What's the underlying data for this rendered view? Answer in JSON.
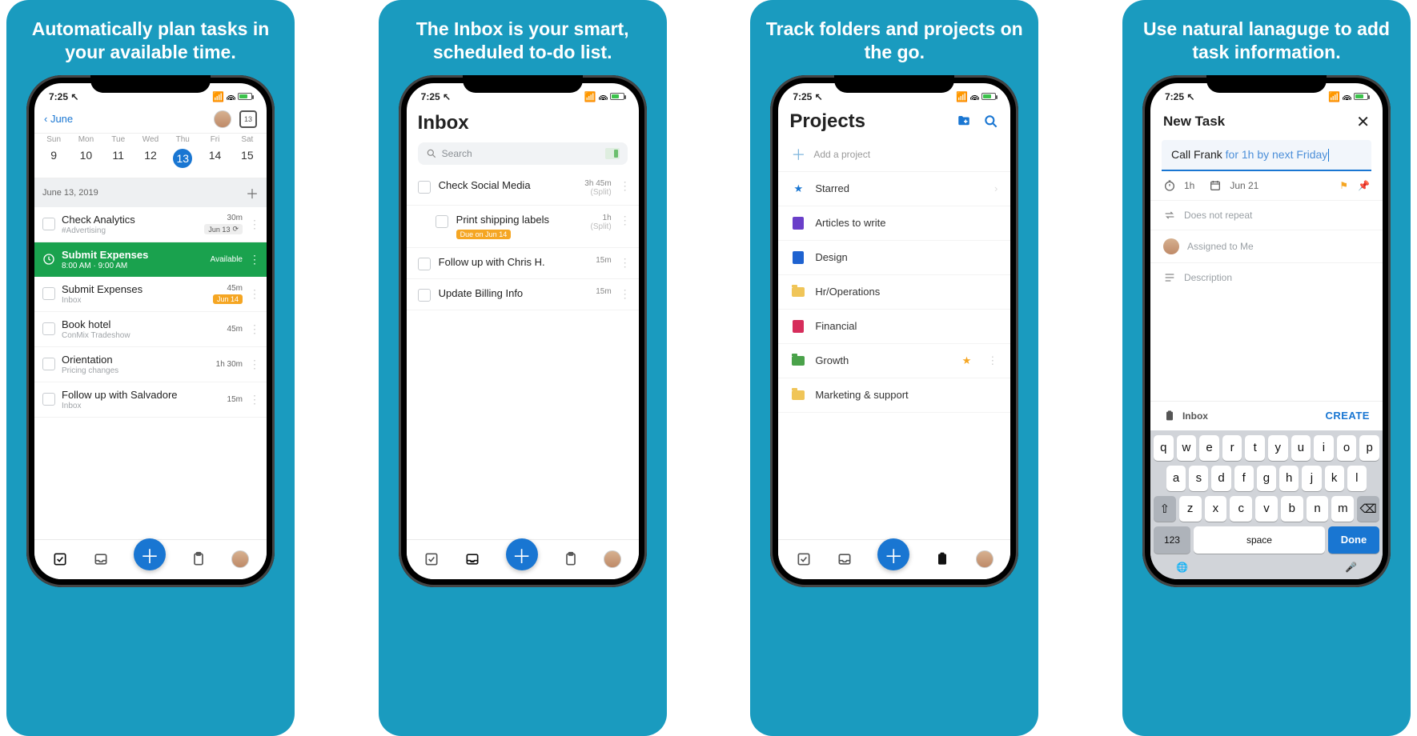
{
  "status": {
    "time": "7:25",
    "dayIcon": "13"
  },
  "panels": [
    {
      "caption": "Automatically plan tasks in your available time."
    },
    {
      "caption": "The Inbox is your smart, scheduled to-do list."
    },
    {
      "caption": "Track folders and projects on the go."
    },
    {
      "caption": "Use natural lanaguge to add task information."
    }
  ],
  "screen1": {
    "backLabel": "June",
    "weekdays": [
      "Sun",
      "Mon",
      "Tue",
      "Wed",
      "Thu",
      "Fri",
      "Sat"
    ],
    "dates": [
      "9",
      "10",
      "11",
      "12",
      "13",
      "14",
      "15"
    ],
    "selectedIndex": 4,
    "sectionDate": "June 13, 2019",
    "tasks": [
      {
        "title": "Check Analytics",
        "sub": "#Advertising",
        "dur": "30m",
        "badge": "Jun 13",
        "badgeKind": "due",
        "repeat": true
      },
      {
        "title": "Submit Expenses",
        "sub": "8:00 AM · 9:00 AM",
        "dur": "",
        "badge": "Available",
        "badgeKind": "green",
        "highlight": true
      },
      {
        "title": "Submit Expenses",
        "sub": "Inbox",
        "dur": "45m",
        "badge": "Jun 14",
        "badgeKind": "orange"
      },
      {
        "title": "Book hotel",
        "sub": "ConMix Tradeshow",
        "dur": "45m"
      },
      {
        "title": "Orientation",
        "sub": "Pricing changes",
        "dur": "1h 30m"
      },
      {
        "title": "Follow up with Salvadore",
        "sub": "Inbox",
        "dur": "15m"
      }
    ]
  },
  "screen2": {
    "title": "Inbox",
    "searchPlaceholder": "Search",
    "items": [
      {
        "title": "Check Social Media",
        "meta": "3h 45m",
        "sub": "(Split)"
      },
      {
        "title": "Print shipping labels",
        "meta": "1h",
        "sub": "(Split)",
        "due": "Due on Jun 14",
        "indent": true
      },
      {
        "title": "Follow up with Chris H.",
        "meta": "15m"
      },
      {
        "title": "Update Billing Info",
        "meta": "15m"
      }
    ]
  },
  "screen3": {
    "title": "Projects",
    "addLabel": "Add a project",
    "items": [
      {
        "icon": "star",
        "label": "Starred",
        "chev": true
      },
      {
        "icon": "doc",
        "color": "#6a3fc9",
        "label": "Articles to write"
      },
      {
        "icon": "doc",
        "color": "#1e62d0",
        "label": "Design"
      },
      {
        "icon": "folder",
        "color": "#f0c558",
        "label": "Hr/Operations"
      },
      {
        "icon": "doc",
        "color": "#d62d5b",
        "label": "Financial"
      },
      {
        "icon": "folder",
        "color": "#4aa24a",
        "label": "Growth",
        "star": true
      },
      {
        "icon": "folder",
        "color": "#f0c558",
        "label": "Marketing & support"
      }
    ]
  },
  "screen4": {
    "title": "New Task",
    "entry": {
      "text": "Call Frank ",
      "hint": "for 1h by next Friday"
    },
    "timerLabel": "1h",
    "dateLabel": "Jun 21",
    "repeatLabel": "Does not repeat",
    "assignLabel": "Assigned to Me",
    "descLabel": "Description",
    "destLabel": "Inbox",
    "createLabel": "CREATE",
    "kb": {
      "r1": [
        "q",
        "w",
        "e",
        "r",
        "t",
        "y",
        "u",
        "i",
        "o",
        "p"
      ],
      "r2": [
        "a",
        "s",
        "d",
        "f",
        "g",
        "h",
        "j",
        "k",
        "l"
      ],
      "r3": [
        "z",
        "x",
        "c",
        "v",
        "b",
        "n",
        "m"
      ],
      "num": "123",
      "space": "space",
      "done": "Done"
    }
  }
}
